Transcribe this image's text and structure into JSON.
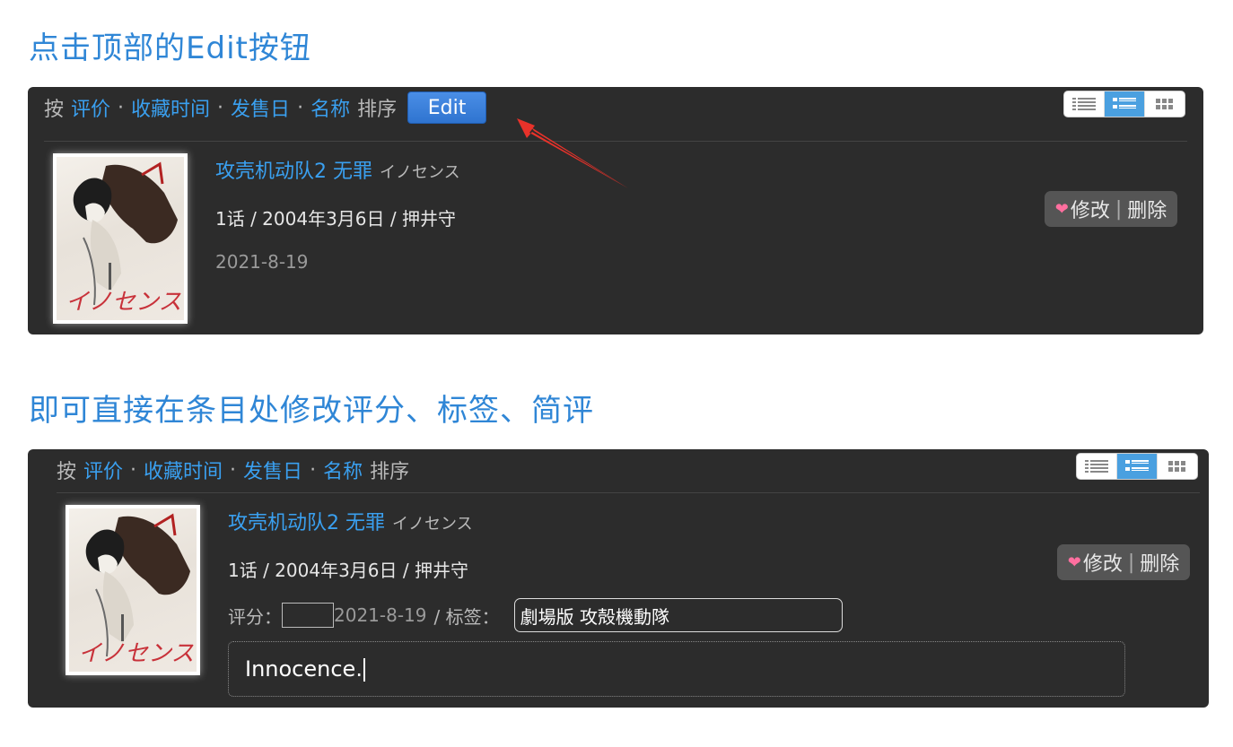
{
  "heading1": "点击顶部的Edit按钮",
  "heading2": "即可直接在条目处修改评分、标签、简评",
  "sortbar": {
    "prefix": "按",
    "options": [
      "评价",
      "收藏时间",
      "发售日",
      "名称"
    ],
    "separator": "·",
    "suffix": "排序",
    "edit_label": "Edit"
  },
  "view_modes": [
    "list-icon",
    "detail-list-icon",
    "grid-icon"
  ],
  "item": {
    "title": "攻壳机动队2 无罪",
    "subtitle": "イノセンス",
    "info": "1话 / 2004年3月6日 / 押井守",
    "date": "2021-8-19",
    "cover_text": "イノセンス",
    "actions": {
      "edit": "修改",
      "separator": "|",
      "delete": "删除"
    }
  },
  "edit_form": {
    "rating_label": "评分：",
    "rating_value": "",
    "date": "2021-8-19",
    "tags_label": "/ 标签：",
    "tags_value": "劇場版 攻殻機動隊",
    "comment": "Innocence."
  },
  "colors": {
    "accent": "#2f86d6",
    "link": "#3aa0f0",
    "panel": "#2c2c2c",
    "annotation_arrow": "#e8322a"
  }
}
